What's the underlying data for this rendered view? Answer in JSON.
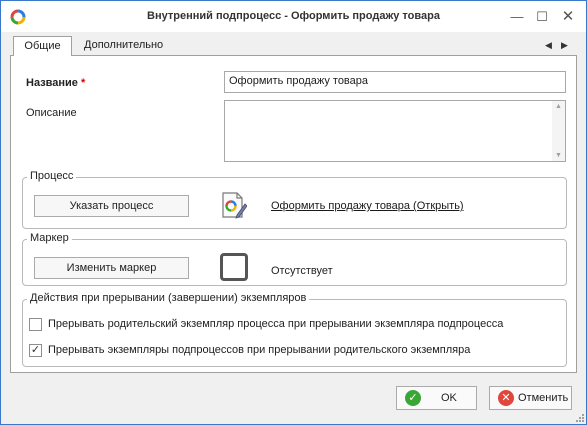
{
  "window": {
    "title": "Внутренний подпроцесс - Оформить продажу товара",
    "min_glyph": "—",
    "max_glyph": "☐",
    "close_glyph": "✕"
  },
  "tabs": {
    "active": "Общие",
    "inactive": "Дополнительно"
  },
  "form": {
    "name_label": "Название",
    "required_mark": "*",
    "name_value": "Оформить продажу товара",
    "description_label": "Описание",
    "description_value": ""
  },
  "process_group": {
    "title": "Процесс",
    "button_label": "Указать процесс",
    "link_text": "Оформить продажу товара (Открыть)",
    "icon": "document-edit-icon"
  },
  "marker_group": {
    "title": "Маркер",
    "button_label": "Изменить маркер",
    "status_text": "Отсутствует"
  },
  "actions_group": {
    "title": "Действия при прерывании (завершении) экземпляров",
    "options": [
      {
        "label": "Прерывать родительский экземпляр процесса при прерывании экземпляра подпроцесса",
        "checked": false
      },
      {
        "label": "Прерывать экземпляры подпроцессов при прерывании родительского экземпляра",
        "checked": true
      }
    ]
  },
  "footer": {
    "ok_label": "OK",
    "cancel_label": "Отменить"
  },
  "colors": {
    "window_border": "#3a78c9",
    "ok_icon": "#3aa635",
    "cancel_icon": "#e0463b"
  }
}
